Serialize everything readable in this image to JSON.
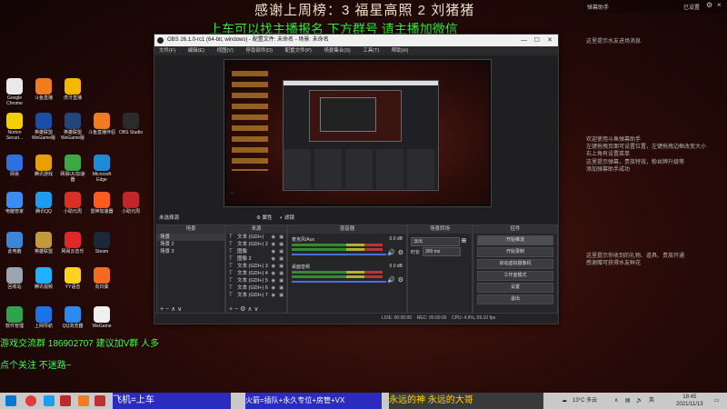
{
  "overlay": {
    "line1": "感谢上周榜：3 福星高照 2 刘猪猪",
    "line2": "上车可以找主播报名 下方群号 请主播加微信"
  },
  "right_panel": {
    "header": "弹幕助手",
    "header_right": "已设置",
    "items": [
      "这里提示水友进场消息",
      "欢迎使用斗鱼弹幕助手",
      "左键拖拽页面可设置位置，左键拖拽边框改变大小",
      "右上角有设置菜单",
      "这里提示弹幕，贵族特效，粉丝牌升级等",
      "添加弹幕助手成功",
      "这里提示你收到的礼物、道具、贵族开通",
      "感谢赠可获得水友鲜花"
    ]
  },
  "desktop_icons": [
    {
      "label": "Google Chrome",
      "color": "#e9e9e9"
    },
    {
      "label": "斗鱼直播",
      "color": "#f07c1f"
    },
    {
      "label": "虎牙直播",
      "color": "#f5b700"
    },
    {
      "label": "Norton Securi...",
      "color": "#f2d000"
    },
    {
      "label": "英雄联盟WeGame版",
      "color": "#1b4da8"
    },
    {
      "label": "英雄联盟WeGame版",
      "color": "#23467a"
    },
    {
      "label": "斗鱼直播伴侣",
      "color": "#f07c1f"
    },
    {
      "label": "OBS Studio",
      "color": "#2b2b2b"
    },
    {
      "label": "网易",
      "color": "#2f6fe0"
    },
    {
      "label": "腾讯游戏",
      "color": "#e8a000"
    },
    {
      "label": "网易UU加速器",
      "color": "#39a845"
    },
    {
      "label": "Microsoft Edge",
      "color": "#1f8ad7"
    },
    {
      "label": "电脑管家",
      "color": "#3d8cf0"
    },
    {
      "label": "腾讯QQ",
      "color": "#1e9cf0"
    },
    {
      "label": "小助元周",
      "color": "#d93025"
    },
    {
      "label": "雷神加速器",
      "color": "#ff5b1f"
    },
    {
      "label": "小助元周",
      "color": "#c0262b"
    },
    {
      "label": "此电脑",
      "color": "#3a86d8"
    },
    {
      "label": "英雄联盟",
      "color": "#c29a3b"
    },
    {
      "label": "网易云音乐",
      "color": "#e02828"
    },
    {
      "label": "Steam",
      "color": "#1b2838"
    },
    {
      "label": "回收站",
      "color": "#9aa5b1"
    },
    {
      "label": "腾讯视频",
      "color": "#1fb1ff"
    },
    {
      "label": "YY语音",
      "color": "#ffd21f"
    },
    {
      "label": "向日葵",
      "color": "#f36b21"
    },
    {
      "label": "软件管理",
      "color": "#2da44e"
    },
    {
      "label": "上网导航",
      "color": "#1a73e8"
    },
    {
      "label": "QQ浏览器",
      "color": "#2a8cf0"
    },
    {
      "label": "WeGame",
      "color": "#f0f0f0"
    }
  ],
  "obs": {
    "title": "OBS 26.1.0-rc1 (64-bit, windows) - 配置文件: 未命名 - 场景: 未命名",
    "menu": [
      "文件(F)",
      "编辑(E)",
      "视图(V)",
      "停靠部件(D)",
      "配置文件(P)",
      "场景集合(S)",
      "工具(T)",
      "帮助(H)"
    ],
    "source_label": "未选择源",
    "props_btn": "属性",
    "filters_btn": "滤镜",
    "panels": {
      "scenes": "场景",
      "sources": "来源",
      "mixer": "混音器",
      "transitions": "场景转场",
      "controls": "控件"
    },
    "scenes": [
      "场景",
      "场景 2",
      "场景 3"
    ],
    "sources": [
      "文本 (GDI+)",
      "文本 (GDI+) 2",
      "图像",
      "图像 2",
      "文本 (GDI+) 3",
      "文本 (GDI+) 4",
      "文本 (GDI+) 5",
      "文本 (GDI+) 6",
      "文本 (GDI+) 7"
    ],
    "mixer": [
      {
        "name": "桌面音频",
        "db": "0.0 dB"
      },
      {
        "name": "麦克风/Aux",
        "db": "0.0 dB"
      }
    ],
    "transition": {
      "type": "淡出",
      "duration_label": "时长",
      "duration": "300 ms"
    },
    "controls": [
      "开始推流",
      "开始录制",
      "启动虚拟摄像机",
      "工作室模式",
      "设置",
      "退出"
    ],
    "status": {
      "live": "LIVE: 00:00:00",
      "rec": "REC: 00:00:00",
      "cpu": "CPU: 4.9%, 59.10 fps"
    }
  },
  "chat": {
    "line1": "游戏交流群 186902707 建议加V群 人多",
    "line2": "点个关注 不迷路~"
  },
  "taskbar": {
    "ticker1": "飞机=上车",
    "ticker2": "火箭=插队+永久专位+房管+VX",
    "ticker3": "永远的神 永远的大哥",
    "weather": "13°C 多云",
    "time": "18:45",
    "date": "2021/11/13",
    "lang": "英"
  },
  "colors": {
    "green_text": "#4bff4b",
    "obs_bg": "#1f1f22",
    "start_stream": "#4d4d52"
  }
}
